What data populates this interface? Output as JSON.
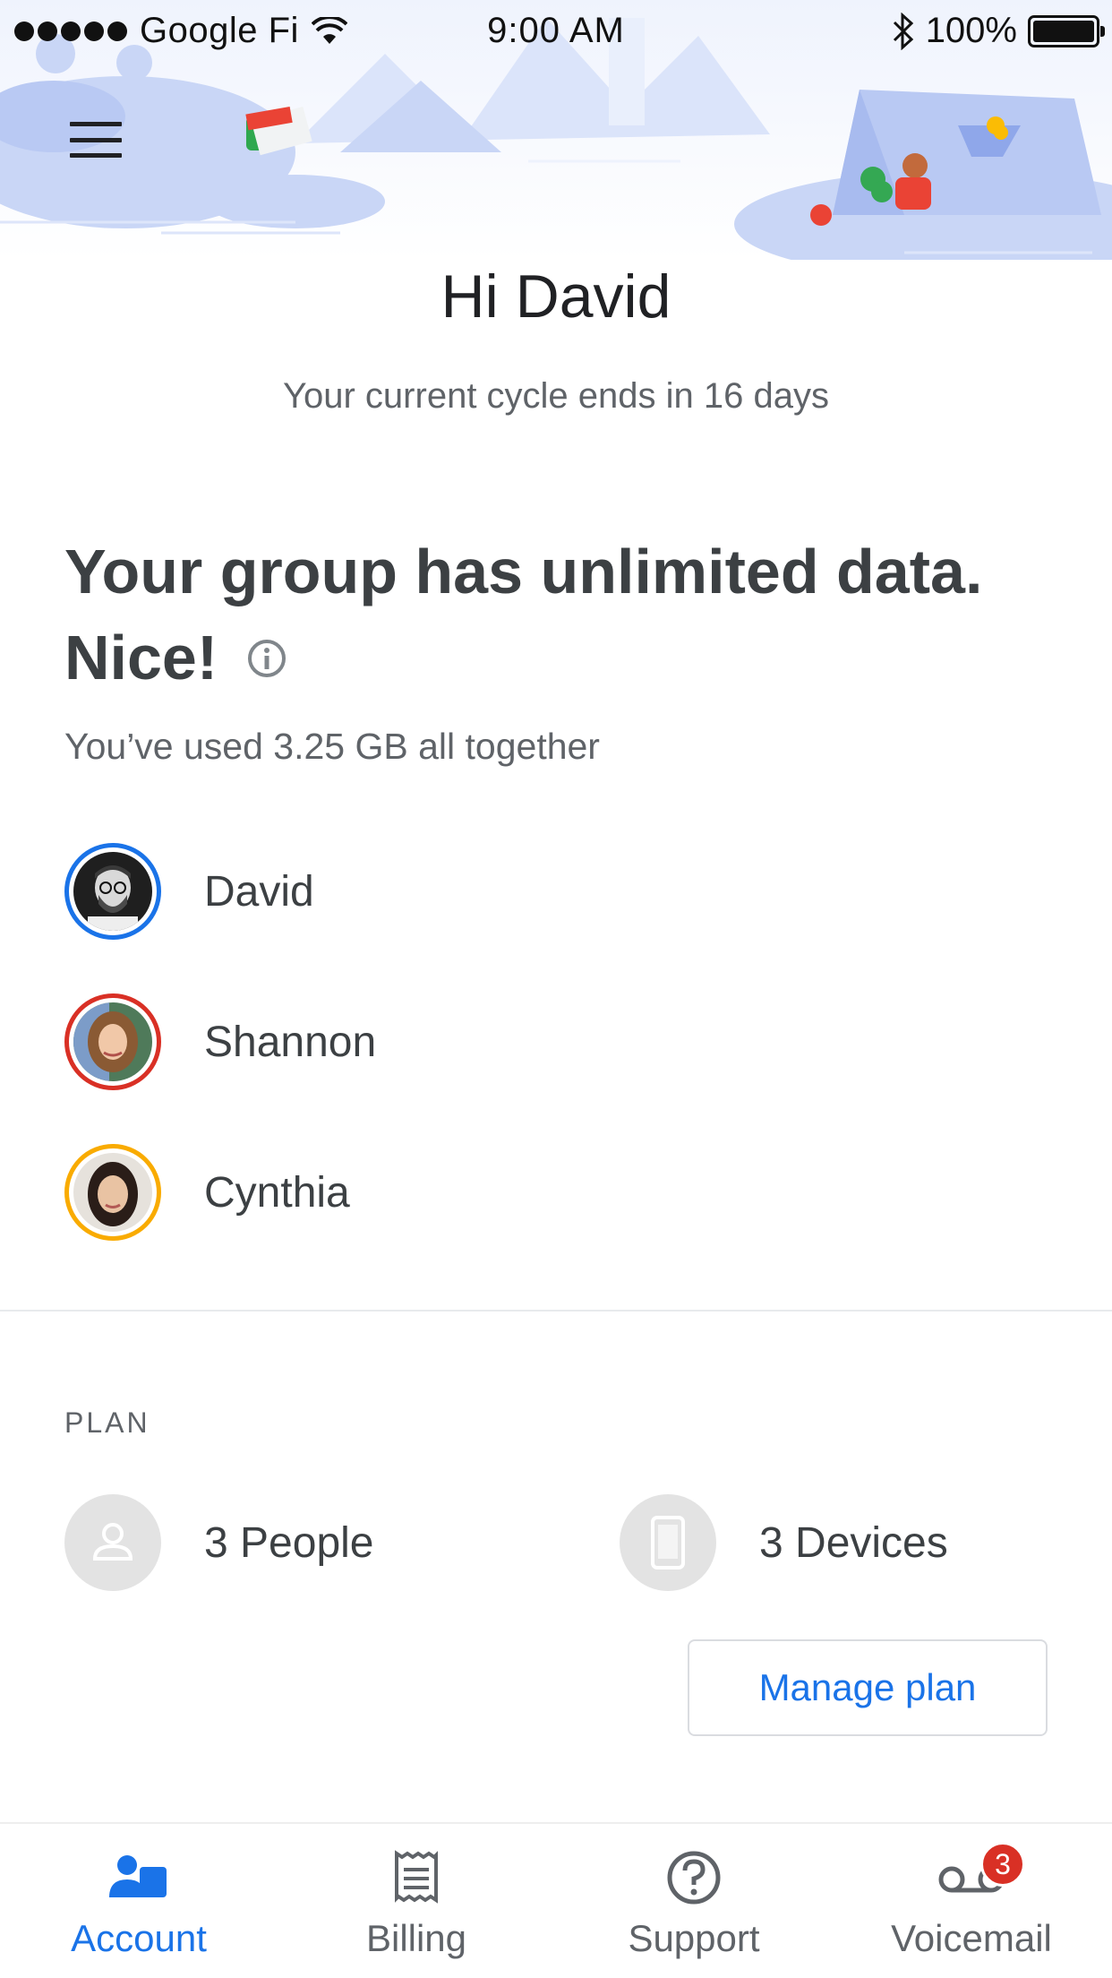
{
  "status_bar": {
    "carrier": "Google Fi",
    "time": "9:00 AM",
    "battery": "100%",
    "battery_level": 1.0
  },
  "header": {
    "greeting": "Hi David",
    "cycle_text": "Your current cycle ends in 16 days"
  },
  "data_summary": {
    "headline": "Your group has unlimited data. Nice!",
    "usage_text": "You’ve used 3.25 GB all together"
  },
  "members": [
    {
      "name": "David",
      "ring_color": "#1a73e8"
    },
    {
      "name": "Shannon",
      "ring_color": "#d93025"
    },
    {
      "name": "Cynthia",
      "ring_color": "#f9ab00"
    }
  ],
  "plan": {
    "label": "PLAN",
    "people": "3 People",
    "devices": "3 Devices",
    "manage_label": "Manage plan"
  },
  "bottom_nav": {
    "tabs": [
      {
        "label": "Account",
        "icon": "account-icon",
        "active": true
      },
      {
        "label": "Billing",
        "icon": "receipt-icon",
        "active": false
      },
      {
        "label": "Support",
        "icon": "help-icon",
        "active": false
      },
      {
        "label": "Voicemail",
        "icon": "voicemail-icon",
        "active": false,
        "badge": "3"
      }
    ]
  },
  "colors": {
    "accent": "#1a73e8",
    "badge": "#d93025",
    "illustration": "#c6d4f5"
  }
}
